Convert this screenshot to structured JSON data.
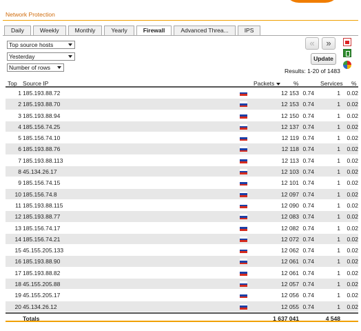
{
  "page": {
    "title": "Network Protection"
  },
  "tabs": [
    {
      "label": "Daily",
      "active": false
    },
    {
      "label": "Weekly",
      "active": false
    },
    {
      "label": "Monthly",
      "active": false
    },
    {
      "label": "Yearly",
      "active": false
    },
    {
      "label": "Firewall",
      "active": true
    },
    {
      "label": "Advanced Threa...",
      "active": false
    },
    {
      "label": "IPS",
      "active": false
    }
  ],
  "filters": {
    "report_select": "Top source hosts",
    "period_select": "Yesterday",
    "rows_select": "Number of rows"
  },
  "toolbar": {
    "prev_label": "«",
    "next_label": "»",
    "update_label": "Update",
    "results_text": "Results: 1-20 of 1483",
    "icons": [
      "pdf-icon",
      "excel-icon",
      "pie-chart-icon"
    ]
  },
  "table": {
    "columns": {
      "top": "Top",
      "source_ip": "Source IP",
      "packets": "Packets",
      "pct": "%",
      "services": "Services",
      "pct2": "%"
    },
    "flag_colors": [
      "#ffffff",
      "#1c3fa6",
      "#d52b1e"
    ],
    "rows": [
      {
        "top": "1",
        "ip": "185.193.88.72",
        "packets": "12 153",
        "pct": "0.74",
        "services": "1",
        "pct2": "0.02"
      },
      {
        "top": "2",
        "ip": "185.193.88.70",
        "packets": "12 153",
        "pct": "0.74",
        "services": "1",
        "pct2": "0.02"
      },
      {
        "top": "3",
        "ip": "185.193.88.94",
        "packets": "12 150",
        "pct": "0.74",
        "services": "1",
        "pct2": "0.02"
      },
      {
        "top": "4",
        "ip": "185.156.74.25",
        "packets": "12 137",
        "pct": "0.74",
        "services": "1",
        "pct2": "0.02"
      },
      {
        "top": "5",
        "ip": "185.156.74.10",
        "packets": "12 119",
        "pct": "0.74",
        "services": "1",
        "pct2": "0.02"
      },
      {
        "top": "6",
        "ip": "185.193.88.76",
        "packets": "12 118",
        "pct": "0.74",
        "services": "1",
        "pct2": "0.02"
      },
      {
        "top": "7",
        "ip": "185.193.88.113",
        "packets": "12 113",
        "pct": "0.74",
        "services": "1",
        "pct2": "0.02"
      },
      {
        "top": "8",
        "ip": "45.134.26.17",
        "packets": "12 103",
        "pct": "0.74",
        "services": "1",
        "pct2": "0.02"
      },
      {
        "top": "9",
        "ip": "185.156.74.15",
        "packets": "12 101",
        "pct": "0.74",
        "services": "1",
        "pct2": "0.02"
      },
      {
        "top": "10",
        "ip": "185.156.74.8",
        "packets": "12 097",
        "pct": "0.74",
        "services": "1",
        "pct2": "0.02"
      },
      {
        "top": "11",
        "ip": "185.193.88.115",
        "packets": "12 090",
        "pct": "0.74",
        "services": "1",
        "pct2": "0.02"
      },
      {
        "top": "12",
        "ip": "185.193.88.77",
        "packets": "12 083",
        "pct": "0.74",
        "services": "1",
        "pct2": "0.02"
      },
      {
        "top": "13",
        "ip": "185.156.74.17",
        "packets": "12 082",
        "pct": "0.74",
        "services": "1",
        "pct2": "0.02"
      },
      {
        "top": "14",
        "ip": "185.156.74.21",
        "packets": "12 072",
        "pct": "0.74",
        "services": "1",
        "pct2": "0.02"
      },
      {
        "top": "15",
        "ip": "45.155.205.133",
        "packets": "12 062",
        "pct": "0.74",
        "services": "1",
        "pct2": "0.02"
      },
      {
        "top": "16",
        "ip": "185.193.88.90",
        "packets": "12 061",
        "pct": "0.74",
        "services": "1",
        "pct2": "0.02"
      },
      {
        "top": "17",
        "ip": "185.193.88.82",
        "packets": "12 061",
        "pct": "0.74",
        "services": "1",
        "pct2": "0.02"
      },
      {
        "top": "18",
        "ip": "45.155.205.88",
        "packets": "12 057",
        "pct": "0.74",
        "services": "1",
        "pct2": "0.02"
      },
      {
        "top": "19",
        "ip": "45.155.205.17",
        "packets": "12 056",
        "pct": "0.74",
        "services": "1",
        "pct2": "0.02"
      },
      {
        "top": "20",
        "ip": "45.134.26.12",
        "packets": "12 055",
        "pct": "0.74",
        "services": "1",
        "pct2": "0.02"
      }
    ],
    "totals": {
      "label": "Totals",
      "packets": "1 637 041",
      "services": "4 548"
    }
  }
}
